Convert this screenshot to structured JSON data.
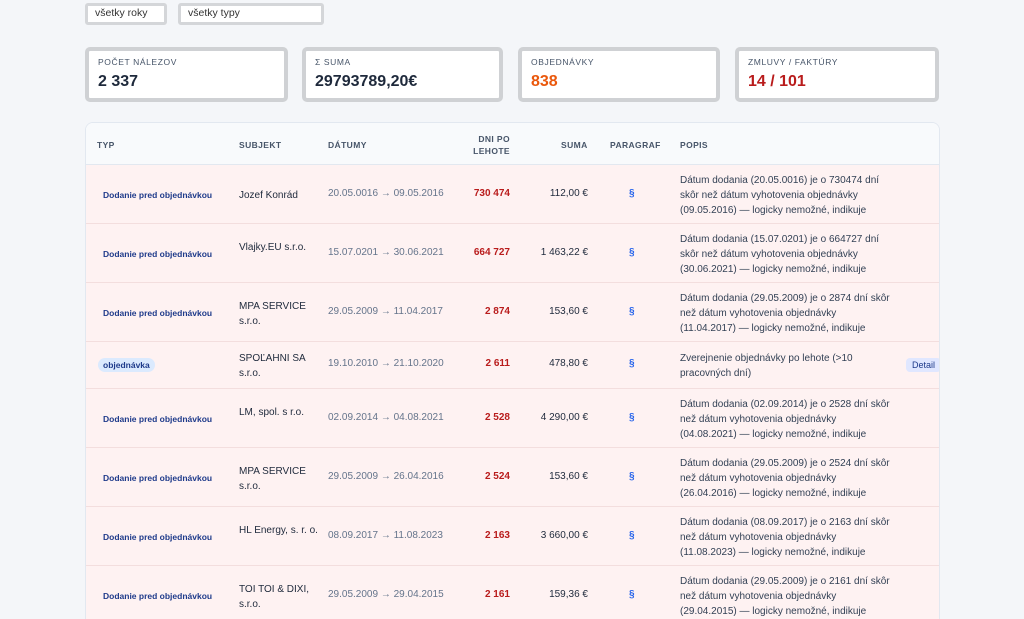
{
  "filters": {
    "year": "všetky roky",
    "type": "všetky typy"
  },
  "stats": [
    {
      "label": "POČET NÁLEZOV",
      "value": "2 337",
      "color": "#1e293b"
    },
    {
      "label": "Σ SUMA",
      "value": "29793789,20€",
      "color": "#1e293b"
    },
    {
      "label": "OBJEDNÁVKY",
      "value": "838",
      "color": "#ea580c"
    },
    {
      "label": "ZMLUVY / FAKTÚRY",
      "value": "14 / 101",
      "color": "#b91c1c"
    }
  ],
  "table": {
    "headers": {
      "typ": "TYP",
      "subjekt": "SUBJEKT",
      "datumy": "DÁTUMY",
      "dni_line1": "DNI PO",
      "dni_line2": "LEHOTE",
      "suma": "SUMA",
      "paragraf": "PARAGRAF",
      "popis": "POPIS"
    },
    "rows": [
      {
        "typ": "Dodanie pred objednávkou",
        "subjekt": "Jozef Konrád",
        "datumy": "20.05.0016 → 09.05.2016",
        "dni": "730 474",
        "suma": "112,00 €",
        "paragraf": "§",
        "popis": "Dátum dodania (20.05.0016) je o 730474 dní skôr než dátum vyhotovenia objednávky (09.05.2016) — logicky nemožné, indikuje",
        "detail": ""
      },
      {
        "typ": "Dodanie pred objednávkou",
        "subjekt": "Vlajky.EU s.r.o.",
        "datumy": "15.07.0201 → 30.06.2021",
        "dni": "664 727",
        "suma": "1 463,22 €",
        "paragraf": "§",
        "popis": "Dátum dodania (15.07.0201) je o 664727 dní skôr než dátum vyhotovenia objednávky (30.06.2021) — logicky nemožné, indikuje",
        "detail": ""
      },
      {
        "typ": "Dodanie pred objednávkou",
        "subjekt": "MPA SERVICE s.r.o.",
        "datumy": "29.05.2009 → 11.04.2017",
        "dni": "2 874",
        "suma": "153,60 €",
        "paragraf": "§",
        "popis": "Dátum dodania (29.05.2009) je o 2874 dní skôr než dátum vyhotovenia objednávky (11.04.2017) — logicky nemožné, indikuje",
        "detail": ""
      },
      {
        "typ": "objednávka",
        "subjekt": "SPOĽAHNI SA s.r.o.",
        "datumy": "19.10.2010 → 21.10.2020",
        "dni": "2 611",
        "suma": "478,80 €",
        "paragraf": "§",
        "popis": "Zverejnenie objednávky po lehote (>10 pracovných dní)",
        "detail": "Detail"
      },
      {
        "typ": "Dodanie pred objednávkou",
        "subjekt": "LM, spol. s r.o.",
        "datumy": "02.09.2014 → 04.08.2021",
        "dni": "2 528",
        "suma": "4 290,00 €",
        "paragraf": "§",
        "popis": "Dátum dodania (02.09.2014) je o 2528 dní skôr než dátum vyhotovenia objednávky (04.08.2021) — logicky nemožné, indikuje",
        "detail": ""
      },
      {
        "typ": "Dodanie pred objednávkou",
        "subjekt": "MPA SERVICE s.r.o.",
        "datumy": "29.05.2009 → 26.04.2016",
        "dni": "2 524",
        "suma": "153,60 €",
        "paragraf": "§",
        "popis": "Dátum dodania (29.05.2009) je o 2524 dní skôr než dátum vyhotovenia objednávky (26.04.2016) — logicky nemožné, indikuje",
        "detail": ""
      },
      {
        "typ": "Dodanie pred objednávkou",
        "subjekt": "HL Energy, s. r. o.",
        "datumy": "08.09.2017 → 11.08.2023",
        "dni": "2 163",
        "suma": "3 660,00 €",
        "paragraf": "§",
        "popis": "Dátum dodania (08.09.2017) je o 2163 dní skôr než dátum vyhotovenia objednávky (11.08.2023) — logicky nemožné, indikuje",
        "detail": ""
      },
      {
        "typ": "Dodanie pred objednávkou",
        "subjekt": "TOI TOI & DIXI, s.r.o.",
        "datumy": "29.05.2009 → 29.04.2015",
        "dni": "2 161",
        "suma": "159,36 €",
        "paragraf": "§",
        "popis": "Dátum dodania (29.05.2009) je o 2161 dní skôr než dátum vyhotovenia objednávky (29.04.2015) — logicky nemožné, indikuje",
        "detail": ""
      }
    ]
  }
}
